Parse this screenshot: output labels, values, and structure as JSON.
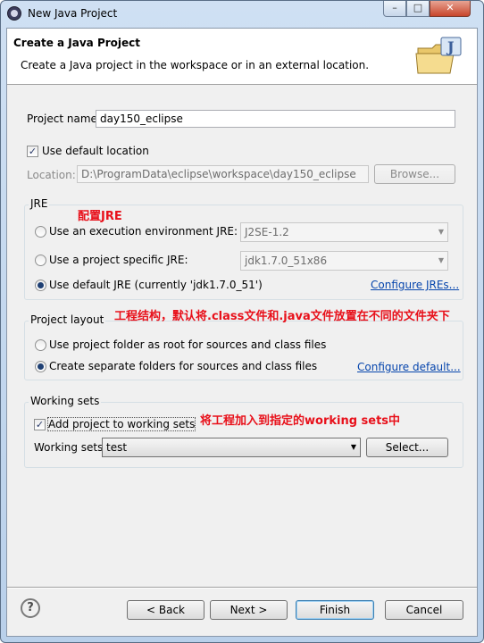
{
  "window": {
    "title": "New Java Project",
    "icon": "eclipse-icon",
    "controls": {
      "minimize": "–",
      "maximize": "□",
      "close": "✕"
    }
  },
  "banner": {
    "title": "Create a Java Project",
    "description": "Create a Java project in the workspace or in an external location.",
    "icon": "java-project-folder-icon"
  },
  "project": {
    "name_label": "Project name:",
    "name_value": "day150_eclipse"
  },
  "location": {
    "use_default_label": "Use default location",
    "use_default_checked": true,
    "location_label": "Location:",
    "location_value": "D:\\ProgramData\\eclipse\\workspace\\day150_eclipse",
    "browse_label": "Browse..."
  },
  "jre": {
    "group_title": "JRE",
    "annotation": "配置JRE",
    "options": [
      {
        "label": "Use an execution environment JRE:",
        "checked": false,
        "combo": "J2SE-1.2"
      },
      {
        "label": "Use a project specific JRE:",
        "checked": false,
        "combo": "jdk1.7.0_51x86"
      },
      {
        "label": "Use default JRE (currently 'jdk1.7.0_51')",
        "checked": true
      }
    ],
    "configure_link": "Configure JREs..."
  },
  "layout": {
    "group_title": "Project layout",
    "annotation": "工程结构，默认将.class文件和.java文件放置在不同的文件夹下",
    "options": [
      {
        "label": "Use project folder as root for sources and class files",
        "checked": false
      },
      {
        "label": "Create separate folders for sources and class files",
        "checked": true
      }
    ],
    "configure_link": "Configure default..."
  },
  "working_sets": {
    "group_title": "Working sets",
    "add_label": "Add project to working sets",
    "add_checked": true,
    "annotation": "将工程加入到指定的working sets中",
    "sets_label": "Working sets:",
    "sets_value": "test",
    "select_label": "Select..."
  },
  "footer": {
    "help": "?",
    "back": "< Back",
    "next": "Next >",
    "finish": "Finish",
    "cancel": "Cancel"
  },
  "colors": {
    "annotation": "#e8101a",
    "link": "#0645ad",
    "title_bar": "#b9d0ea",
    "close_button": "#c7452b"
  }
}
